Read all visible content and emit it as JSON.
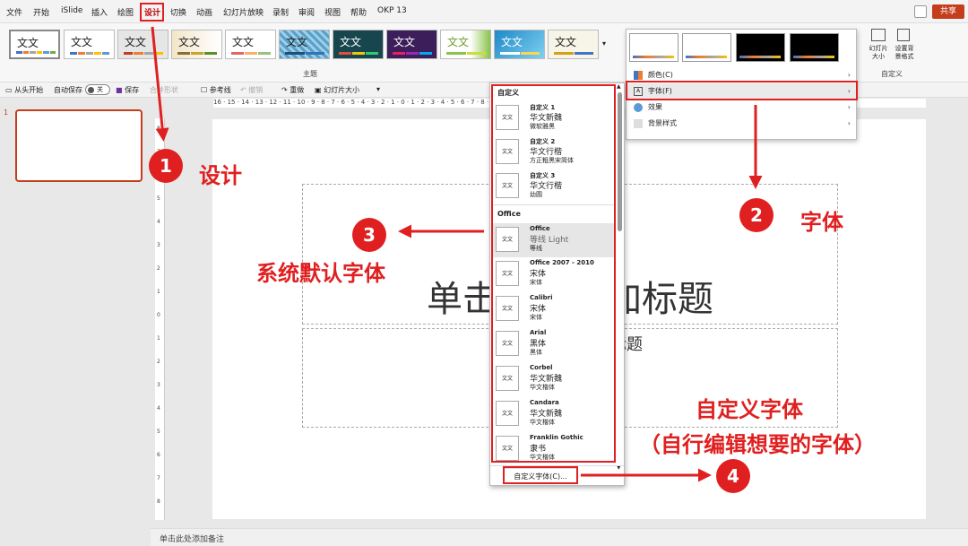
{
  "menu": [
    "文件",
    "开始",
    "iSlide",
    "插入",
    "绘图",
    "设计",
    "切换",
    "动画",
    "幻灯片放映",
    "录制",
    "审阅",
    "视图",
    "帮助",
    "OKP 13"
  ],
  "share_label": "共享",
  "themes_group_label": "主题",
  "theme_thumb_text": "文文",
  "customize_group_label": "自定义",
  "slide_size_label": "幻灯片大小",
  "format_bg_label": "设置背景格式",
  "toolbar": {
    "from_start": "从头开始",
    "autosave": "自动保存",
    "autosave_state": "关",
    "save": "保存",
    "combine": "合并形状",
    "guides": "参考线",
    "undo": "撤销",
    "redo": "重做",
    "slide_size": "幻灯片大小"
  },
  "slide_number": "1",
  "ruler_text": "16 · 15 · 14 · 13 · 12 · 11 · 10 · 9 · 8 · 7 · 6 · 5 · 4 · 3 · 2 · 1 · 0 · 1 · 2 · 3 · 4 · 5 · 6 · 7 · 8 · 9 · 10 · 11 · 12 · 13 · 14 · 15 · 16",
  "vruler_text": [
    "8",
    "7",
    "6",
    "5",
    "4",
    "3",
    "2",
    "1",
    "0",
    "1",
    "2",
    "3",
    "4",
    "5",
    "6",
    "7",
    "8"
  ],
  "slide": {
    "title_visible": "单击此处添加标题",
    "subtitle_visible": "单击此处添加副标题"
  },
  "status_notes": "单击此处添加备注",
  "font_panel": {
    "section_custom": "自定义",
    "section_office": "Office",
    "icon_text": "文文",
    "fonts": [
      {
        "name": "自定义 1",
        "heading": "华文新魏",
        "body": "微软雅黑"
      },
      {
        "name": "自定义 2",
        "heading": "华文行楷",
        "body": "方正粗黑宋简体"
      },
      {
        "name": "自定义 3",
        "heading": "华文行楷",
        "body": "幼圆"
      },
      {
        "name": "Office",
        "heading": "等线 Light",
        "body": "等线"
      },
      {
        "name": "Office 2007 - 2010",
        "heading": "宋体",
        "body": "宋体"
      },
      {
        "name": "Calibri",
        "heading": "宋体",
        "body": "宋体"
      },
      {
        "name": "Arial",
        "heading": "黑体",
        "body": "黑体"
      },
      {
        "name": "Corbel",
        "heading": "华文新魏",
        "body": "华文楷体"
      },
      {
        "name": "Candara",
        "heading": "华文新魏",
        "body": "华文楷体"
      },
      {
        "name": "Franklin Gothic",
        "heading": "隶书",
        "body": "华文楷体"
      }
    ],
    "custom_button": "自定义字体(C)..."
  },
  "variants_menu": [
    {
      "label": "颜色(C)"
    },
    {
      "label": "字体(F)"
    },
    {
      "label": "效果"
    },
    {
      "label": "背景样式"
    }
  ],
  "annotations": {
    "step1_num": "1",
    "step1_label": "设计",
    "step2_num": "2",
    "step2_label": "字体",
    "step3_num": "3",
    "step3_label": "系统默认字体",
    "step4_num": "4",
    "custom_line1": "自定义字体",
    "custom_line2": "（自行编辑想要的字体）"
  },
  "colors": {
    "accent": "#c43e1c",
    "annotation": "#e02020"
  }
}
